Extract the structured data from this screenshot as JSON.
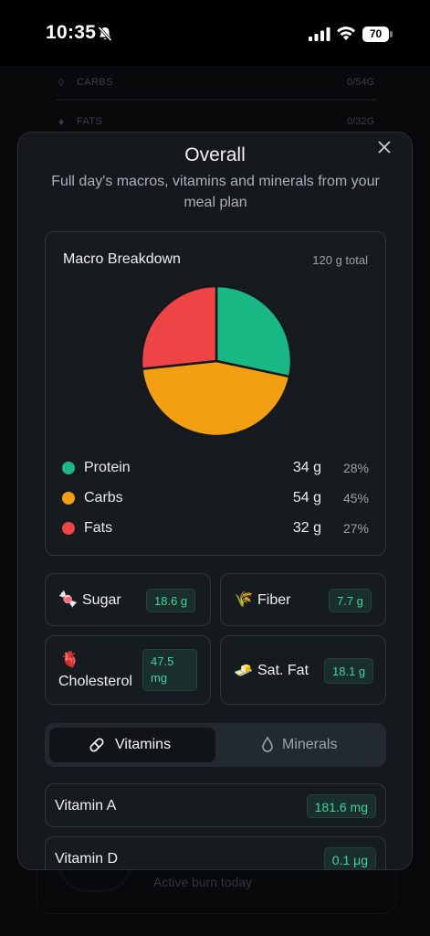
{
  "status_bar": {
    "time": "10:35",
    "battery": "70"
  },
  "background": {
    "rows": [
      {
        "label": "CARBS",
        "value": "0/54G"
      },
      {
        "label": "FATS",
        "value": "0/32G"
      }
    ],
    "caption": "Active burn today"
  },
  "sheet": {
    "title": "Overall",
    "subtitle": "Full day's macros, vitamins and minerals from your meal plan",
    "macro": {
      "title": "Macro Breakdown",
      "total": "120 g total"
    },
    "stats": {
      "sugar": {
        "label": "Sugar",
        "value": "18.6 g",
        "emoji": "🍬"
      },
      "fiber": {
        "label": "Fiber",
        "value": "7.7 g",
        "emoji": "🌾"
      },
      "cholesterol": {
        "label": "Cholesterol",
        "value_line1": "47.5",
        "value_line2": "mg",
        "emoji": "🫀"
      },
      "satfat": {
        "label": "Sat. Fat",
        "value": "18.1 g",
        "emoji": "🧈"
      }
    },
    "tabs": {
      "vitamins": "Vitamins",
      "minerals": "Minerals",
      "active": "Vitamins"
    },
    "vitamins": [
      {
        "name": "Vitamin A",
        "value": "181.6 mg"
      },
      {
        "name": "Vitamin D",
        "value": "0.1 μg"
      }
    ]
  },
  "chart_data": {
    "type": "pie",
    "labels": [
      "Protein",
      "Carbs",
      "Fats"
    ],
    "values": [
      34,
      54,
      32
    ],
    "units": "g",
    "percent_labels": [
      "28%",
      "45%",
      "27%"
    ],
    "colors": [
      "#19b885",
      "#f29f12",
      "#ee4446"
    ]
  }
}
